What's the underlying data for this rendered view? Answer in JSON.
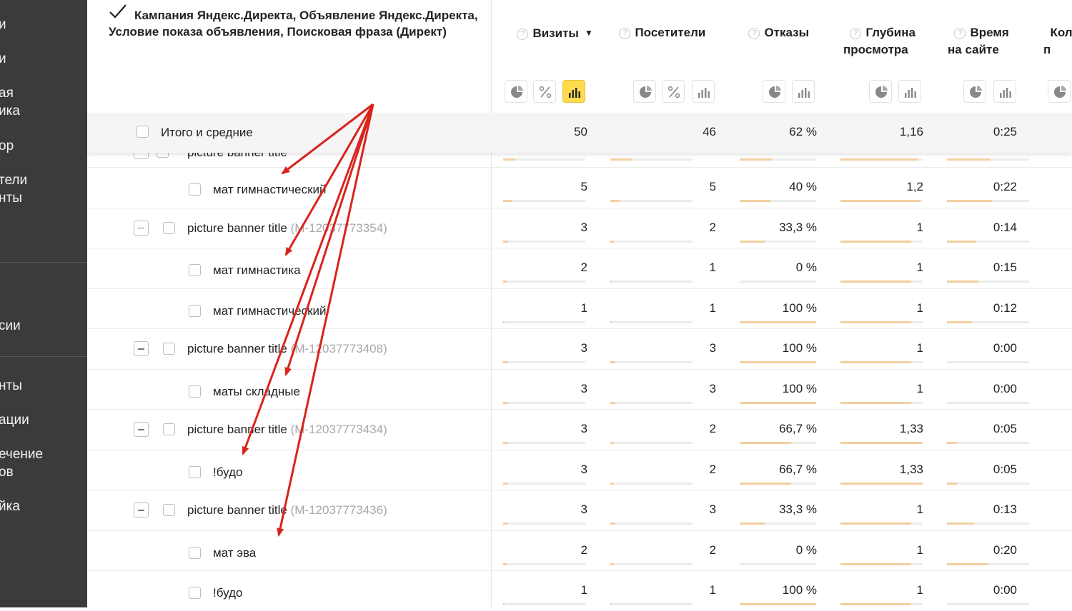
{
  "sidebar": {
    "items": [
      {
        "label": "и"
      },
      {
        "label": "ая\nика"
      },
      {
        "label": "ор"
      },
      {
        "label": "тели\nнты"
      },
      {
        "label": "сии"
      },
      {
        "label": "нты"
      },
      {
        "label": "ации"
      },
      {
        "label": "ечение\nов"
      },
      {
        "label": "йка"
      }
    ]
  },
  "table": {
    "dimension_header": "Кампания Яндекс.Директа, Объявление Яндекс.Директа, Условие показа объявления, Поисковая фраза (Директ)",
    "metric_headers": [
      {
        "label": "Визиты",
        "sorted": true
      },
      {
        "label": "Посетители"
      },
      {
        "label": "Отказы"
      },
      {
        "label": "Глубина\nпросмотра"
      },
      {
        "label": "Время\nна сайте"
      },
      {
        "label": "Коли\nп"
      }
    ],
    "totals": {
      "label": "Итого и средние",
      "visits": "50",
      "visitors": "46",
      "bounce": "62 %",
      "depth": "1,16",
      "time": "0:25"
    },
    "rows": [
      {
        "type": "phrase",
        "label": "мат гимнастический",
        "visits": "5",
        "visitors": "5",
        "bounce": "40 %",
        "depth": "1,2",
        "time": "0:22",
        "f": [
          0.1,
          0.11,
          0.4,
          0.97,
          0.55
        ]
      },
      {
        "type": "ad",
        "label": "picture banner title",
        "id": "(M-12037773354)",
        "visits": "3",
        "visitors": "2",
        "bounce": "33,3 %",
        "depth": "1",
        "time": "0:14",
        "f": [
          0.06,
          0.04,
          0.33,
          0.86,
          0.35
        ]
      },
      {
        "type": "phrase",
        "label": "мат гимнастика",
        "visits": "2",
        "visitors": "1",
        "bounce": "0 %",
        "depth": "1",
        "time": "0:15",
        "f": [
          0.04,
          0.02,
          0.0,
          0.86,
          0.38
        ]
      },
      {
        "type": "phrase",
        "label": "мат гимнастический",
        "visits": "1",
        "visitors": "1",
        "bounce": "100 %",
        "depth": "1",
        "time": "0:12",
        "f": [
          0.02,
          0.02,
          1.0,
          0.86,
          0.3
        ]
      },
      {
        "type": "ad",
        "label": "picture banner title",
        "id": "(M-12037773408)",
        "visits": "3",
        "visitors": "3",
        "bounce": "100 %",
        "depth": "1",
        "time": "0:00",
        "f": [
          0.06,
          0.06,
          1.0,
          0.86,
          0.0
        ]
      },
      {
        "type": "phrase",
        "label": "маты складные",
        "visits": "3",
        "visitors": "3",
        "bounce": "100 %",
        "depth": "1",
        "time": "0:00",
        "f": [
          0.06,
          0.06,
          1.0,
          0.86,
          0.0
        ]
      },
      {
        "type": "ad",
        "label": "picture banner title",
        "id": "(M-12037773434)",
        "visits": "3",
        "visitors": "2",
        "bounce": "66,7 %",
        "depth": "1,33",
        "time": "0:05",
        "f": [
          0.06,
          0.04,
          0.67,
          1.0,
          0.12
        ]
      },
      {
        "type": "phrase",
        "label": "!будо",
        "visits": "3",
        "visitors": "2",
        "bounce": "66,7 %",
        "depth": "1,33",
        "time": "0:05",
        "f": [
          0.06,
          0.04,
          0.67,
          1.0,
          0.12
        ]
      },
      {
        "type": "ad",
        "label": "picture banner title",
        "id": "(M-12037773436)",
        "visits": "3",
        "visitors": "3",
        "bounce": "33,3 %",
        "depth": "1",
        "time": "0:13",
        "f": [
          0.06,
          0.06,
          0.33,
          0.86,
          0.33
        ]
      },
      {
        "type": "phrase",
        "label": "мат эва",
        "visits": "2",
        "visitors": "2",
        "bounce": "0 %",
        "depth": "1",
        "time": "0:20",
        "f": [
          0.04,
          0.04,
          0.0,
          0.86,
          0.5
        ]
      },
      {
        "type": "phrase",
        "label": "!будо",
        "visits": "1",
        "visitors": "1",
        "bounce": "100 %",
        "depth": "1",
        "time": "0:00",
        "f": [
          0.02,
          0.02,
          1.0,
          0.86,
          0.0
        ]
      }
    ]
  },
  "colors": {
    "accent": "#ffdb4d",
    "bar": "#f3cfa0",
    "arrow": "#d9241c",
    "sidebar": "#3b3b3b"
  }
}
